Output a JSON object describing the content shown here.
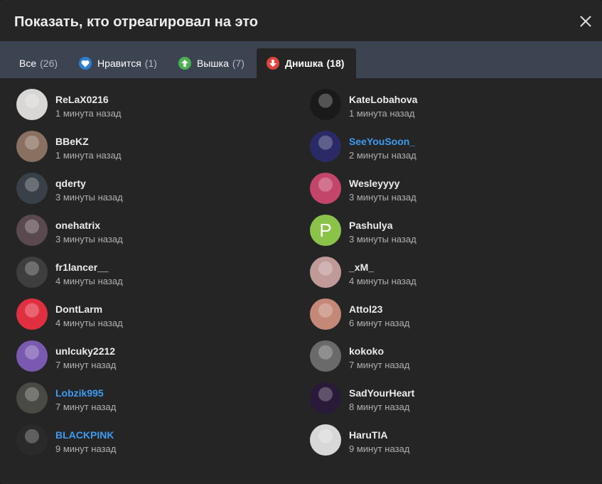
{
  "dialog": {
    "title": "Показать, кто отреагировал на это"
  },
  "tabs": [
    {
      "label": "Все",
      "count": "(26)",
      "icon": null
    },
    {
      "label": "Нравится",
      "count": "(1)",
      "icon": "heart-icon",
      "color": "#2f7fd1"
    },
    {
      "label": "Вышка",
      "count": "(7)",
      "icon": "arrow-up-icon",
      "color": "#4caf50"
    },
    {
      "label": "Днишка",
      "count": "(18)",
      "icon": "arrow-down-icon",
      "color": "#e0443e"
    }
  ],
  "users_left": [
    {
      "name": "ReLaX0216",
      "time": "1 минута назад",
      "highlight": false,
      "avatar_color": "#d9d6d6"
    },
    {
      "name": "BBeKZ",
      "time": "1 минута назад",
      "highlight": false,
      "avatar_color": "#8a7060"
    },
    {
      "name": "qderty",
      "time": "3 минуты назад",
      "highlight": false,
      "avatar_color": "#3a4048"
    },
    {
      "name": "onehatrix",
      "time": "3 минуты назад",
      "highlight": false,
      "avatar_color": "#5a4a4f"
    },
    {
      "name": "fr1lancer__",
      "time": "4 минуты назад",
      "highlight": false,
      "avatar_color": "#3e3e3e"
    },
    {
      "name": "DontLarm",
      "time": "4 минуты назад",
      "highlight": false,
      "avatar_color": "#e03040"
    },
    {
      "name": "unlcuky2212",
      "time": "7 минут назад",
      "highlight": false,
      "avatar_color": "#7a5ab0"
    },
    {
      "name": "Lobzik995",
      "time": "7 минут назад",
      "highlight": true,
      "avatar_color": "#4a4a44"
    },
    {
      "name": "BLACKPINK",
      "time": "9 минут назад",
      "highlight": true,
      "avatar_color": "#2a2a2a"
    }
  ],
  "users_right": [
    {
      "name": "KateLobahova",
      "time": "1 минута назад",
      "highlight": false,
      "avatar_color": "#1a1a1a"
    },
    {
      "name": "SeeYouSoon_",
      "time": "2 минуты назад",
      "highlight": true,
      "avatar_color": "#2a2a66"
    },
    {
      "name": "Wesleyyyy",
      "time": "3 минуты назад",
      "highlight": false,
      "avatar_color": "#c4456a"
    },
    {
      "name": "Pashulya",
      "time": "3 минуты назад",
      "highlight": false,
      "avatar_color": "#8bc34a",
      "letter": "P"
    },
    {
      "name": "_xM_",
      "time": "4 минуты назад",
      "highlight": false,
      "avatar_color": "#c09a98"
    },
    {
      "name": "Attol23",
      "time": "6 минут назад",
      "highlight": false,
      "avatar_color": "#c48878"
    },
    {
      "name": "kokoko",
      "time": "7 минут назад",
      "highlight": false,
      "avatar_color": "#6a6a6a"
    },
    {
      "name": "SadYourHeart",
      "time": "8 минут назад",
      "highlight": false,
      "avatar_color": "#2a1a3a"
    },
    {
      "name": "HaruTIA",
      "time": "9 минут назад",
      "highlight": false,
      "avatar_color": "#d8d8d8"
    }
  ]
}
